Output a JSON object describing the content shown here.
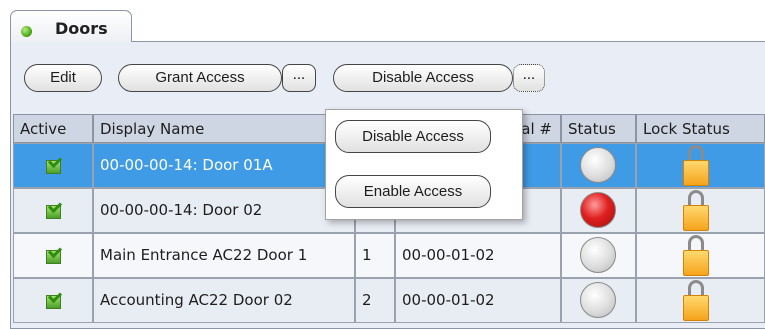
{
  "panel": {
    "tab_title": "Doors"
  },
  "toolbar": {
    "edit_label": "Edit",
    "grant_access_label": "Grant Access",
    "grant_more_label": "...",
    "disable_access_label": "Disable Access",
    "disable_more_label": "..."
  },
  "popup": {
    "items": [
      "Disable Access",
      "Enable Access"
    ]
  },
  "table": {
    "columns": [
      "Active",
      "Display Name",
      "",
      "al #",
      "Status",
      "Lock Status"
    ],
    "rows": [
      {
        "active": true,
        "name": "00-00-00-14: Door 01A",
        "num": "",
        "serial": "",
        "status": "gray",
        "selected": true
      },
      {
        "active": true,
        "name": "00-00-00-14: Door 02",
        "num": "",
        "serial": "",
        "status": "red",
        "selected": false
      },
      {
        "active": true,
        "name": "Main Entrance AC22 Door 1",
        "num": "1",
        "serial": "00-00-01-02",
        "status": "gray",
        "selected": false
      },
      {
        "active": true,
        "name": "Accounting AC22 Door 02",
        "num": "2",
        "serial": "00-00-01-02",
        "status": "gray",
        "selected": false
      }
    ]
  },
  "colors": {
    "selected_row": "#3f9be6",
    "header_bg": "#cfd6e3",
    "status_red": "#d91b1b",
    "lock_gold": "#f6a31b"
  }
}
